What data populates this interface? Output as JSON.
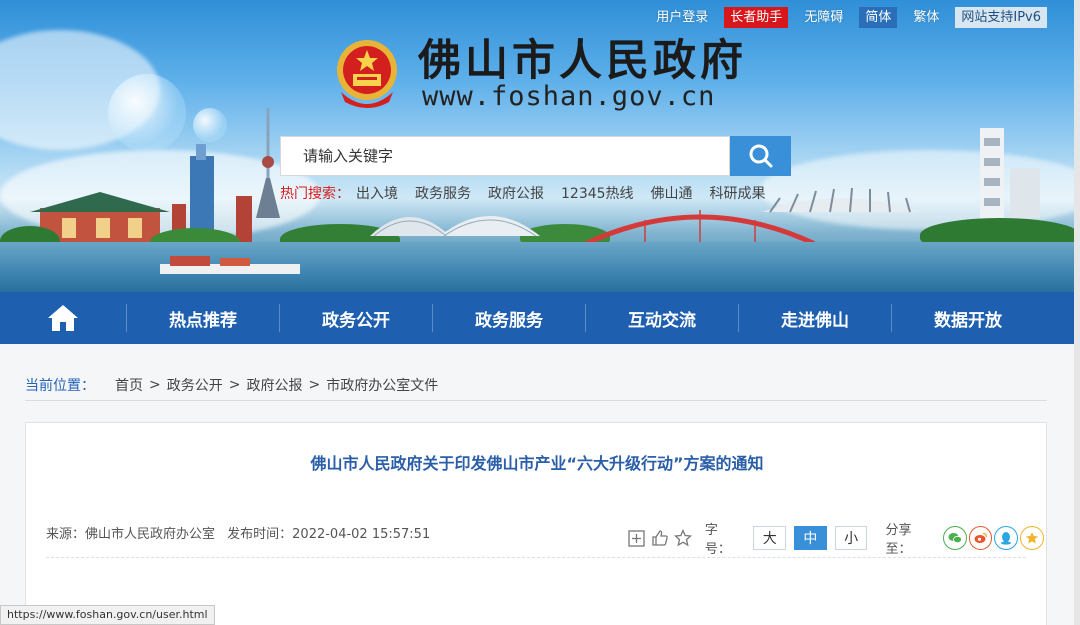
{
  "topbar": {
    "login": "用户登录",
    "elder": "长者助手",
    "accessible": "无障碍",
    "simplified": "简体",
    "traditional": "繁体",
    "ipv6": "网站支持IPv6"
  },
  "site": {
    "title": "佛山市人民政府",
    "url": "www.foshan.gov.cn"
  },
  "search": {
    "placeholder": "请输入关键字"
  },
  "hot": {
    "label": "热门搜索：",
    "items": [
      "出入境",
      "政务服务",
      "政府公报",
      "12345热线",
      "佛山通",
      "科研成果"
    ]
  },
  "nav": {
    "items": [
      "热点推荐",
      "政务公开",
      "政务服务",
      "互动交流",
      "走进佛山",
      "数据开放"
    ]
  },
  "breadcrumb": {
    "label": "当前位置：",
    "items": [
      "首页",
      "政务公开",
      "政府公报",
      "市政府办公室文件"
    ]
  },
  "article": {
    "title": "佛山市人民政府关于印发佛山市产业“六大升级行动”方案的通知",
    "source": "来源：佛山市人民政府办公室",
    "published": "发布时间：2022-04-02 15:57:51",
    "font_label": "字号：",
    "font_sizes": [
      "大",
      "中",
      "小"
    ],
    "share_label": "分享至："
  },
  "status_url": "https://www.foshan.gov.cn/user.html",
  "colors": {
    "nav_bg": "#1e5fb0",
    "accent": "#3a8fd9",
    "elder_red": "#d8171d",
    "title_blue": "#2a5ea8"
  }
}
